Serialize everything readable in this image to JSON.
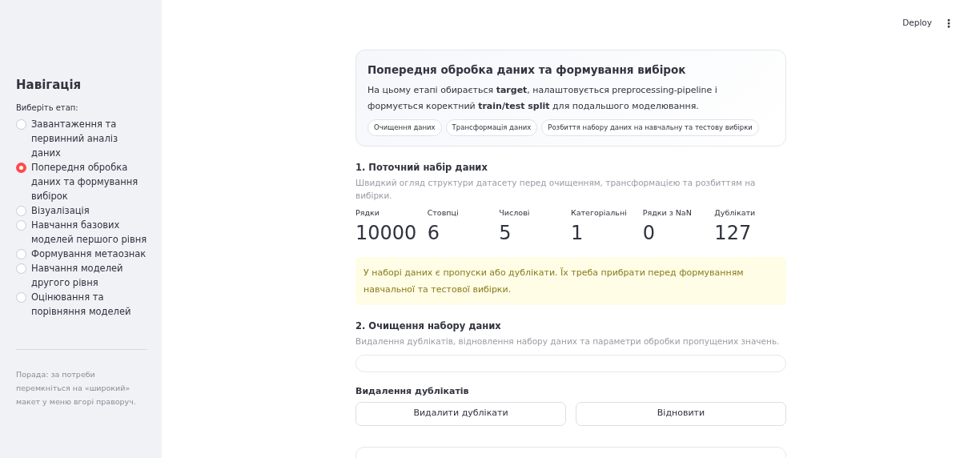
{
  "header": {
    "deploy": "Deploy",
    "menu": "⋮"
  },
  "sidebar": {
    "title": "Навігація",
    "prompt": "Виберіть етап:",
    "stages": [
      {
        "label": "Завантаження та первинний аналіз даних",
        "selected": false
      },
      {
        "label": "Попередня обробка даних та формування вибірок",
        "selected": true
      },
      {
        "label": "Візуалізація",
        "selected": false
      },
      {
        "label": "Навчання базових моделей першого рівня",
        "selected": false
      },
      {
        "label": "Формування метаознак",
        "selected": false
      },
      {
        "label": "Навчання моделей другого рівня",
        "selected": false
      },
      {
        "label": "Оцінювання та порівняння моделей",
        "selected": false
      }
    ],
    "tip": "Порада: за потреби перемкніться на «широкий» макет у меню вгорі праворуч."
  },
  "hero": {
    "title": "Попередня обробка даних та формування вибірок",
    "text": "На цьому етапі обирається **target**, налаштовується preprocessing-pipeline і формується коректний **train/test split** для подальшого моделювання.",
    "tags": [
      "Очищення даних",
      "Трансформація даних",
      "Розбиття набору даних на навчальну та тестову вибірки"
    ]
  },
  "section1": {
    "title": "1. Поточний набір даних",
    "caption": "Швидкий огляд структури датасету перед очищенням, трансформацією та розбиттям на вибірки.",
    "metrics": [
      {
        "label": "Рядки",
        "value": "10000"
      },
      {
        "label": "Стовпці",
        "value": "6"
      },
      {
        "label": "Числові",
        "value": "5"
      },
      {
        "label": "Категоріальні",
        "value": "1"
      },
      {
        "label": "Рядки з NaN",
        "value": "0"
      },
      {
        "label": "Дублікати",
        "value": "127"
      }
    ],
    "warning": "У наборі даних є пропуски або дублікати. Їх треба прибрати перед формуванням навчальної та тестової вибірки."
  },
  "section2": {
    "title": "2. Очищення набору даних",
    "caption": "Видалення дублікатів, відновлення набору даних та параметри обробки пропущених значень.",
    "subtitle": "Видалення дублікатів",
    "buttons": [
      "Видалити дублікати",
      "Відновити"
    ]
  }
}
